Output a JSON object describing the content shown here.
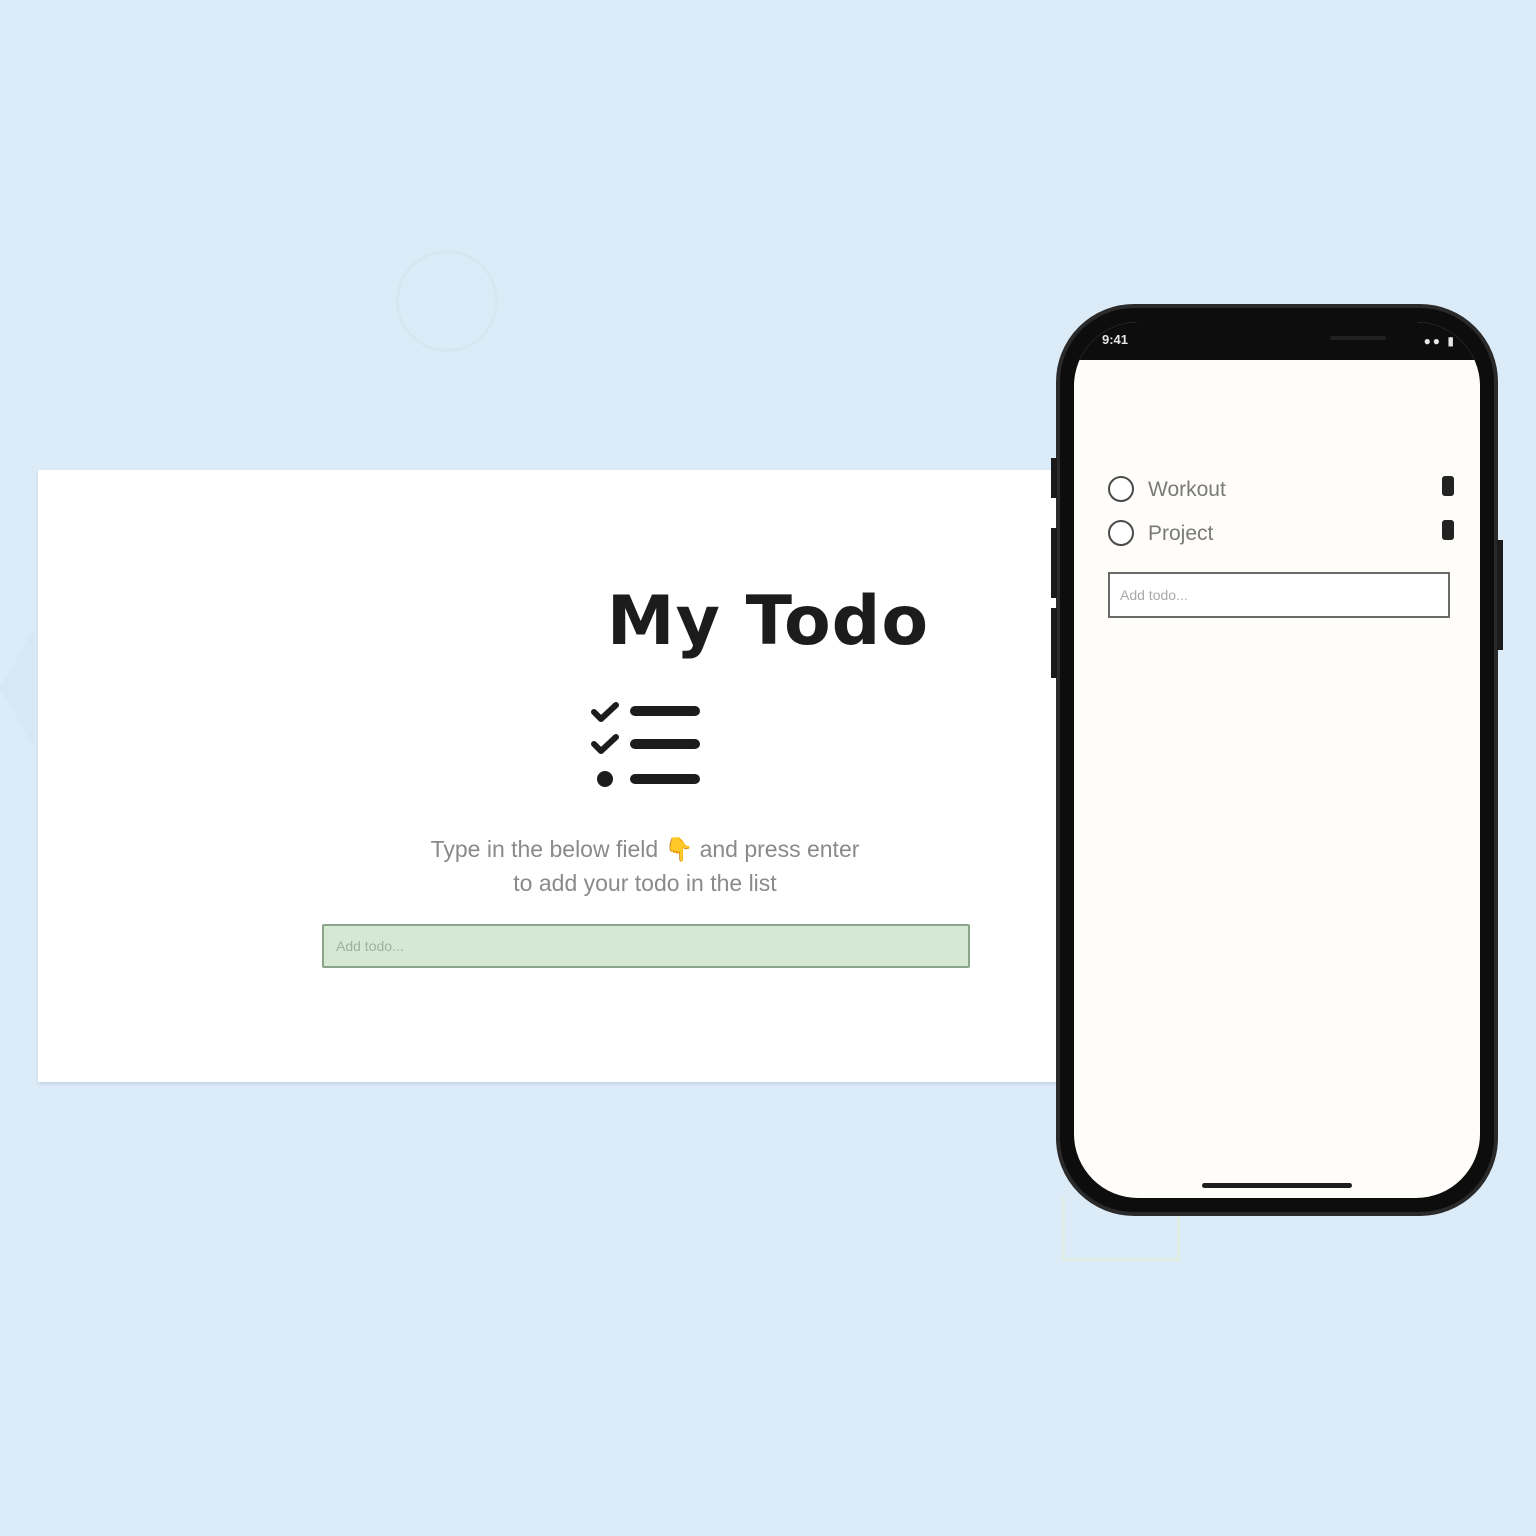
{
  "desktop": {
    "title": "My Todo",
    "instructions": "Type in the below field 👇 and press enter to add your todo in the list",
    "input_placeholder": "Add todo..."
  },
  "phone": {
    "status_time": "9:41",
    "status_icons": "●● ▮",
    "todos": [
      {
        "label": "Workout"
      },
      {
        "label": "Project"
      }
    ],
    "input_placeholder": "Add todo..."
  },
  "colors": {
    "background": "#dcebf8",
    "desktop_input_bg": "#d4e8d4",
    "phone_frame": "#0d0d0d"
  }
}
